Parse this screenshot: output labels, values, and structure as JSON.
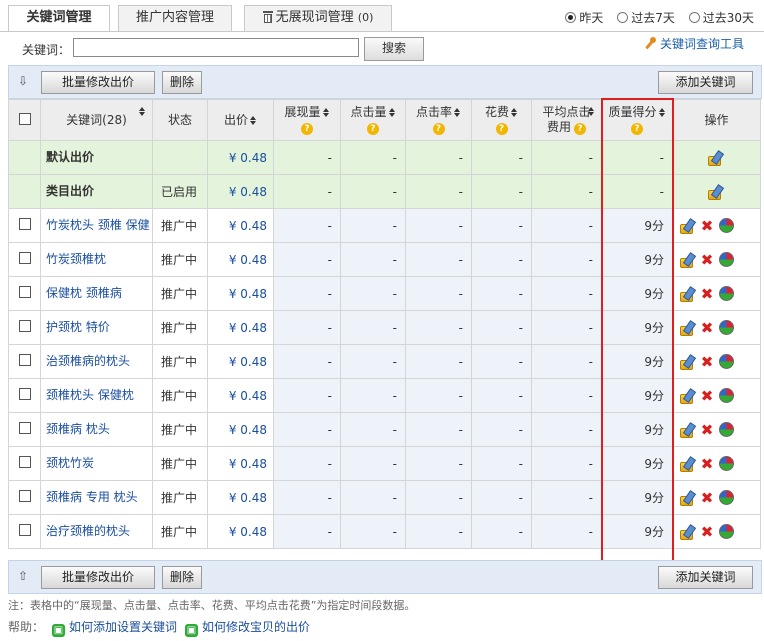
{
  "tabs": [
    {
      "label": "关键词管理"
    },
    {
      "label": "推广内容管理"
    },
    {
      "label": "无展现词管理",
      "count": "(0)"
    }
  ],
  "date_range": {
    "options": [
      "昨天",
      "过去7天",
      "过去30天"
    ],
    "selected": "昨天"
  },
  "search": {
    "label": "关键词：",
    "value": "",
    "button": "搜索"
  },
  "tool_link": "关键词查询工具",
  "toolbar": {
    "batch_edit": "批量修改出价",
    "delete": "删除",
    "add": "添加关键词"
  },
  "columns": {
    "keyword": "关键词(28)",
    "status": "状态",
    "price": "出价",
    "impressions": "展现量",
    "clicks": "点击量",
    "ctr": "点击率",
    "cost": "花费",
    "avg_cpc_1": "平均点击",
    "avg_cpc_2": "费用",
    "quality": "质量得分",
    "ops": "操作"
  },
  "special_rows": [
    {
      "keyword": "默认出价",
      "status": "",
      "price": "¥ 0.48",
      "dash": "-"
    },
    {
      "keyword": "类目出价",
      "status": "已启用",
      "price": "¥ 0.48",
      "dash": "-"
    }
  ],
  "rows": [
    {
      "keyword": "竹炭枕头 颈椎 保健",
      "status": "推广中",
      "price": "¥ 0.48",
      "score": "9分"
    },
    {
      "keyword": "竹炭颈椎枕",
      "status": "推广中",
      "price": "¥ 0.48",
      "score": "9分"
    },
    {
      "keyword": "保健枕 颈椎病",
      "status": "推广中",
      "price": "¥ 0.48",
      "score": "9分"
    },
    {
      "keyword": "护颈枕 特价",
      "status": "推广中",
      "price": "¥ 0.48",
      "score": "9分"
    },
    {
      "keyword": "治颈椎病的枕头",
      "status": "推广中",
      "price": "¥ 0.48",
      "score": "9分"
    },
    {
      "keyword": "颈椎枕头 保健枕",
      "status": "推广中",
      "price": "¥ 0.48",
      "score": "9分"
    },
    {
      "keyword": "颈椎病 枕头",
      "status": "推广中",
      "price": "¥ 0.48",
      "score": "9分"
    },
    {
      "keyword": "颈枕竹炭",
      "status": "推广中",
      "price": "¥ 0.48",
      "score": "9分"
    },
    {
      "keyword": "颈椎病 专用 枕头",
      "status": "推广中",
      "price": "¥ 0.48",
      "score": "9分"
    },
    {
      "keyword": "治疗颈椎的枕头",
      "status": "推广中",
      "price": "¥ 0.48",
      "score": "9分"
    }
  ],
  "dash": "-",
  "note": "注：表格中的“展现量、点击量、点击率、花费、平均点击花费”为指定时间段数据。",
  "help": {
    "label": "帮助：",
    "links": [
      "如何添加设置关键词",
      "如何修改宝贝的出价"
    ]
  }
}
